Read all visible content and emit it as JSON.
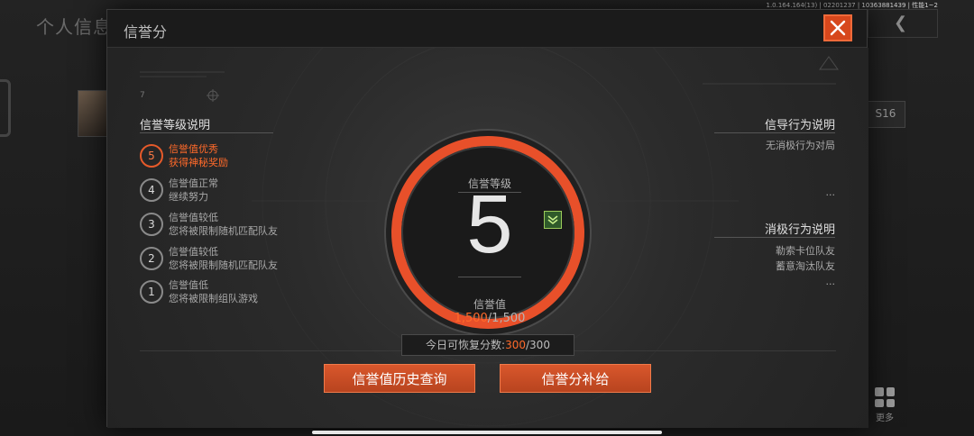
{
  "build_info": "1.0.164.164(13) | 02201237 | 10363881439 | 性能1~2",
  "background": {
    "title": "个人信息",
    "season_badge": "S16",
    "more_label": "更多"
  },
  "modal": {
    "title": "信誉分",
    "left": {
      "title": "信誉等级说明",
      "levels": [
        {
          "num": "5",
          "line1": "信誉值优秀",
          "line2": "获得神秘奖励",
          "active": true
        },
        {
          "num": "4",
          "line1": "信誉值正常",
          "line2": "继续努力",
          "active": false
        },
        {
          "num": "3",
          "line1": "信誉值较低",
          "line2": "您将被限制随机匹配队友",
          "active": false
        },
        {
          "num": "2",
          "line1": "信誉值较低",
          "line2": "您将被限制随机匹配队友",
          "active": false
        },
        {
          "num": "1",
          "line1": "信誉值低",
          "line2": "您将被限制组队游戏",
          "active": false
        }
      ]
    },
    "right": {
      "guide_title": "信导行为说明",
      "guide_items": [
        "无消极行为对局",
        "..."
      ],
      "negative_title": "消极行为说明",
      "negative_items": [
        "勒索卡位队友",
        "蓄意淘汰队友",
        "..."
      ]
    },
    "gauge": {
      "level_label": "信誉等级",
      "level_value": "5",
      "score_label": "信誉值",
      "score_current": "1,500",
      "score_max": "/1,500"
    },
    "recover": {
      "label": "今日可恢复分数:",
      "current": "300",
      "max": "/300"
    },
    "buttons": {
      "history": "信誉值历史查询",
      "supply": "信誉分补给"
    }
  },
  "colors": {
    "accent": "#e8502a",
    "accent_text": "#ff6a2a"
  }
}
